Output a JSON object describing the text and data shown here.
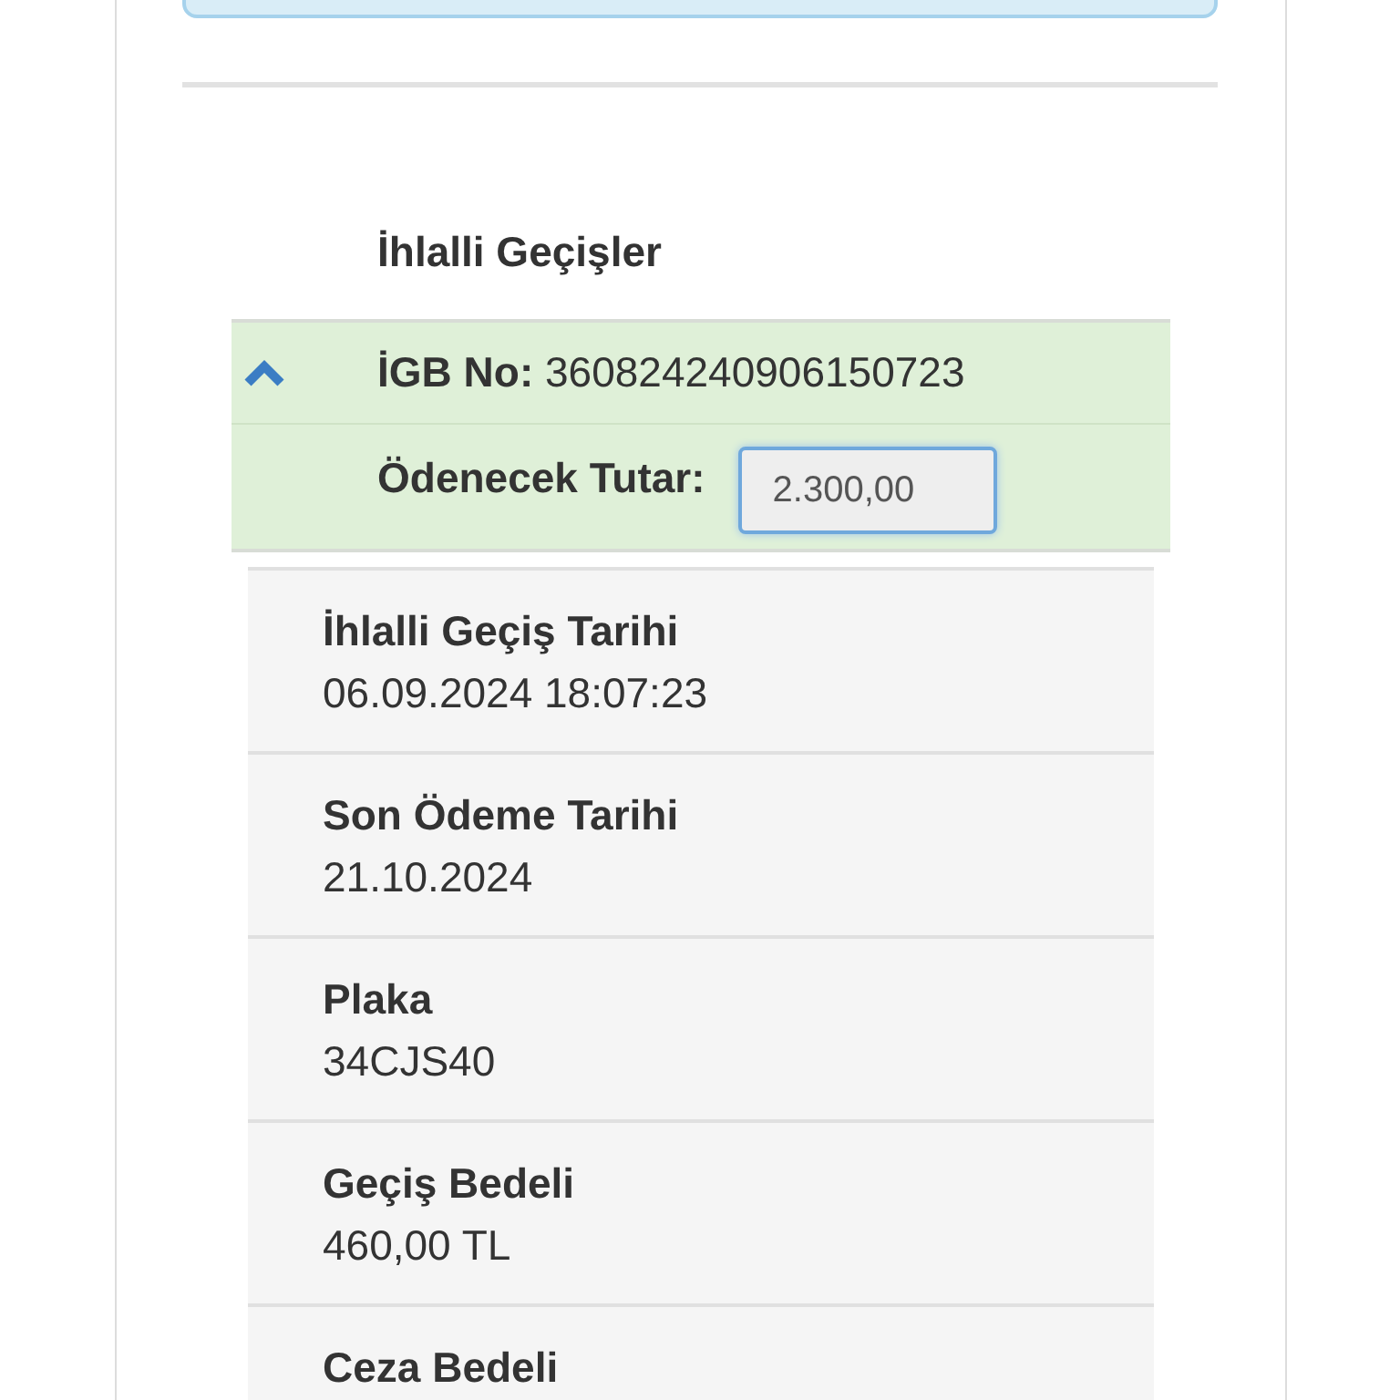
{
  "section_title": "İhlalli Geçişler",
  "violation": {
    "expanded": true,
    "id_label": "İGB No:",
    "id_value": "360824240906150723",
    "amount_label": "Ödenecek Tutar:",
    "amount_value": "2.300,00"
  },
  "details": [
    {
      "label": "İhlalli Geçiş Tarihi",
      "value": "06.09.2024 18:07:23"
    },
    {
      "label": "Son Ödeme Tarihi",
      "value": "21.10.2024"
    },
    {
      "label": "Plaka",
      "value": "34CJS40"
    },
    {
      "label": "Geçiş Bedeli",
      "value": "460,00 TL"
    },
    {
      "label": "Ceza Bedeli"
    }
  ]
}
